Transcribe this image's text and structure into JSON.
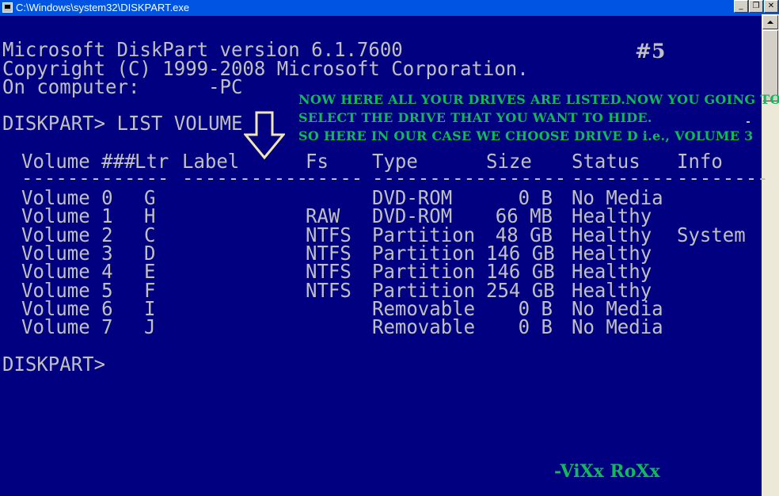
{
  "window": {
    "title": "C:\\Windows\\system32\\DISKPART.exe",
    "minimize_glyph": "_",
    "restore_glyph": "❐",
    "close_glyph": "✕"
  },
  "console": {
    "version_line": "Microsoft DiskPart version 6.1.7600",
    "copyright_line": "Copyright (C) 1999-2008 Microsoft Corporation.",
    "computer_line": "On computer:      -PC",
    "command_line": "DISKPART> LIST VOLUME",
    "table": {
      "headers": [
        "Volume ###",
        "Ltr",
        "Label",
        "Fs",
        "Type",
        "Size",
        "Status",
        "Info"
      ],
      "dividers": [
        "----------",
        "---",
        "-----------",
        "-----",
        "----------",
        "-------",
        "---------",
        "--------"
      ],
      "rows": [
        {
          "vol": "Volume 0",
          "ltr": "G",
          "label": "",
          "fs": "",
          "type": "DVD-ROM",
          "size": "0 B",
          "status": "No Media",
          "info": ""
        },
        {
          "vol": "Volume 1",
          "ltr": "H",
          "label": "",
          "fs": "RAW",
          "type": "DVD-ROM",
          "size": "66 MB",
          "status": "Healthy",
          "info": ""
        },
        {
          "vol": "Volume 2",
          "ltr": "C",
          "label": "",
          "fs": "NTFS",
          "type": "Partition",
          "size": "48 GB",
          "status": "Healthy",
          "info": "System"
        },
        {
          "vol": "Volume 3",
          "ltr": "D",
          "label": "",
          "fs": "NTFS",
          "type": "Partition",
          "size": "146 GB",
          "status": "Healthy",
          "info": ""
        },
        {
          "vol": "Volume 4",
          "ltr": "E",
          "label": "",
          "fs": "NTFS",
          "type": "Partition",
          "size": "146 GB",
          "status": "Healthy",
          "info": ""
        },
        {
          "vol": "Volume 5",
          "ltr": "F",
          "label": "",
          "fs": "NTFS",
          "type": "Partition",
          "size": "254 GB",
          "status": "Healthy",
          "info": ""
        },
        {
          "vol": "Volume 6",
          "ltr": "I",
          "label": "",
          "fs": "",
          "type": "Removable",
          "size": "0 B",
          "status": "No Media",
          "info": ""
        },
        {
          "vol": "Volume 7",
          "ltr": "J",
          "label": "",
          "fs": "",
          "type": "Removable",
          "size": "0 B",
          "status": "No Media",
          "info": ""
        }
      ]
    },
    "prompt": "DISKPART>"
  },
  "annotations": {
    "step_number": "#5",
    "note_line_1": "NOW HERE ALL YOUR DRIVES ARE LISTED.NOW YOU GOING TO",
    "note_line_2": "SELECT THE DRIVE THAT YOU WANT TO HIDE.",
    "note_line_3": "SO HERE IN OUR CASE WE CHOOSE DRIVE D i.e., VOLUME 3",
    "signature": "-ViXx RoXx",
    "arrow_icon": "down-arrow-icon"
  },
  "colors": {
    "console_bg": "#000080",
    "console_text": "#c0c0c0",
    "note_green": "#12b85a",
    "titlebar": "#0054e3"
  }
}
